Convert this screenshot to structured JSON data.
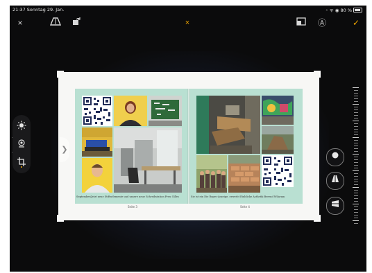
{
  "status_bar": {
    "time_date": "21:37 Sonntag 29. Jan.",
    "icons_text": "◦ ᯤ ◉ 80 %"
  },
  "toolbar": {
    "cancel_icon": "×",
    "perspective_icon": "perspective-icon",
    "rotate_icon": "rotate-icon",
    "reset_icon": "×",
    "aspect_ratio_icon": "aspect-ratio-icon",
    "auto_icon": "Ⓐ",
    "done_icon": "✓",
    "accent_color": "#f0a500"
  },
  "left_tools": {
    "items": [
      "brightness-icon",
      "filter-icon",
      "crop-rotate-icon"
    ],
    "collapse_icon": "❯"
  },
  "photobook": {
    "left_caption": "September/Jetzt neue Stiftselemente und unsere neue Schreibstation Freu Gilles",
    "right_caption": "Sie ist ein Die Repro-Anzeige, erwerbt Einblicke Ästhetik Berend Wilaram",
    "left_page_number": "Seite 3",
    "right_page_number": "Seite 4",
    "page_handle_icon": "❯"
  },
  "right_tools": {
    "items": [
      "straighten-icon",
      "vertical-perspective-icon",
      "horizontal-perspective-icon"
    ]
  }
}
